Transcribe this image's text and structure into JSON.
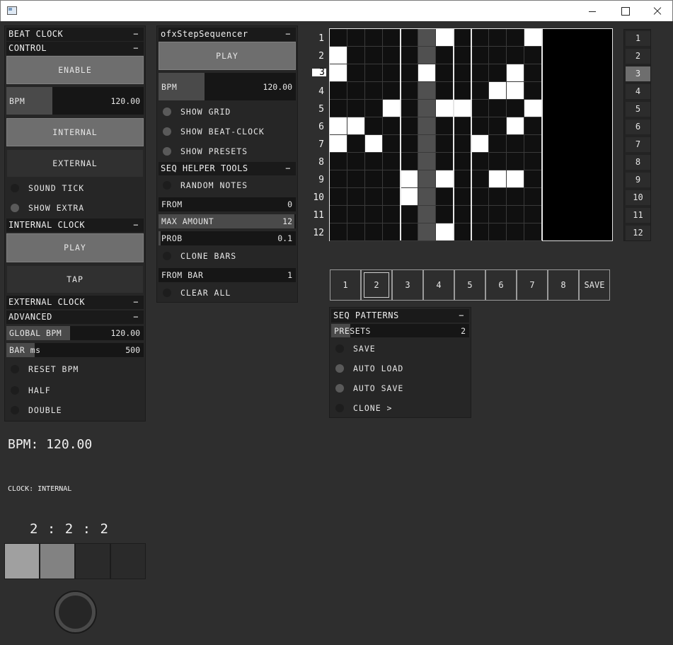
{
  "window": {
    "title": ""
  },
  "beat_clock": {
    "header": "BEAT CLOCK",
    "control_header": "CONTROL",
    "enable": "ENABLE",
    "bpm_label": "BPM",
    "bpm_value": "120.00",
    "internal": "INTERNAL",
    "external": "EXTERNAL",
    "sound_tick": "SOUND TICK",
    "show_extra": "SHOW EXTRA",
    "internal_clock_header": "INTERNAL CLOCK",
    "play": "PLAY",
    "tap": "TAP",
    "external_clock_header": "EXTERNAL CLOCK",
    "advanced_header": "ADVANCED",
    "global_bpm_label": "GLOBAL BPM",
    "global_bpm_value": "120.00",
    "bar_ms_label": "BAR ms",
    "bar_ms_value": "500",
    "reset_bpm": "RESET BPM",
    "half": "HALF",
    "double": "DOUBLE",
    "collapse_symbol": "−"
  },
  "sequencer": {
    "header": "ofxStepSequencer",
    "play": "PLAY",
    "bpm_label": "BPM",
    "bpm_value": "120.00",
    "show_grid": "SHOW GRID",
    "show_beat_clock": "SHOW BEAT-CLOCK",
    "show_presets": "SHOW PRESETS",
    "helper_header": "SEQ HELPER TOOLS",
    "random_notes": "RANDOM NOTES",
    "from_label": "FROM",
    "from_value": "0",
    "max_amount_label": "MAX AMOUNT",
    "max_amount_value": "12",
    "prob_label": "PROB",
    "prob_value": "0.1",
    "clone_bars": "CLONE BARS",
    "from_bar_label": "FROM BAR",
    "from_bar_value": "1",
    "clear_all": "CLEAR ALL"
  },
  "status": {
    "bpm_display": "BPM: 120.00",
    "clock_display": "CLOCK: INTERNAL",
    "beat_counter": "2 : 2 : 2"
  },
  "grid": {
    "row_numbers": [
      "1",
      "2",
      "3",
      "4",
      "5",
      "6",
      "7",
      "8",
      "9",
      "10",
      "11",
      "12"
    ],
    "selected_row": "3",
    "cells": [
      "000000100001",
      "100000000000",
      "100001000010",
      "000000000110",
      "000100110001",
      "110000000010",
      "101000001000",
      "000000000000",
      "000010100110",
      "000010000000",
      "000000000000",
      "000000100000"
    ],
    "current_step": 6
  },
  "right_track": {
    "labels": [
      "1",
      "2",
      "3",
      "4",
      "5",
      "6",
      "7",
      "8",
      "9",
      "10",
      "11",
      "12"
    ],
    "selected": "3"
  },
  "patterns": {
    "labels": [
      "1",
      "2",
      "3",
      "4",
      "5",
      "6",
      "7",
      "8",
      "SAVE"
    ],
    "selected": "2"
  },
  "seq_patterns": {
    "header": "SEQ PATTERNS",
    "presets_label": "PRESETS",
    "presets_value": "2",
    "save": "SAVE",
    "auto_load": "AUTO LOAD",
    "auto_save": "AUTO SAVE",
    "clone": "CLONE >"
  }
}
